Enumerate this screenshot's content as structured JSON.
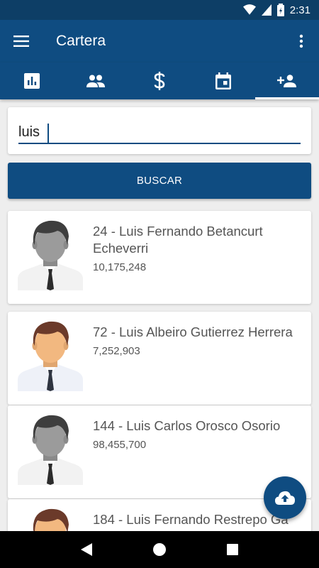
{
  "status_bar": {
    "time": "2:31"
  },
  "app_bar": {
    "title": "Cartera",
    "menu_icon": "menu-icon",
    "more_icon": "more-vert-icon"
  },
  "tabs": [
    {
      "icon": "bar-chart-icon",
      "active": false
    },
    {
      "icon": "people-icon",
      "active": false
    },
    {
      "icon": "dollar-icon",
      "active": false
    },
    {
      "icon": "calendar-icon",
      "active": false
    },
    {
      "icon": "person-add-icon",
      "active": true
    }
  ],
  "search": {
    "value": "luis",
    "button_label": "BUSCAR"
  },
  "results": [
    {
      "name": "24 - Luis Fernando Betancurt Echeverri",
      "value": "10,175,248",
      "avatar": "gray"
    },
    {
      "name": "72 - Luis Albeiro Gutierrez Herrera",
      "value": "7,252,903",
      "avatar": "color"
    },
    {
      "name": "144 - Luis Carlos Orosco Osorio",
      "value": "98,455,700",
      "avatar": "gray"
    },
    {
      "name": "184 - Luis Fernando Restrepo Ga",
      "value": "",
      "avatar": "color"
    }
  ],
  "fab": {
    "icon": "cloud-upload-icon"
  },
  "colors": {
    "primary": "#0f4c81",
    "status": "#0d3e66",
    "background": "#eeeeee"
  }
}
